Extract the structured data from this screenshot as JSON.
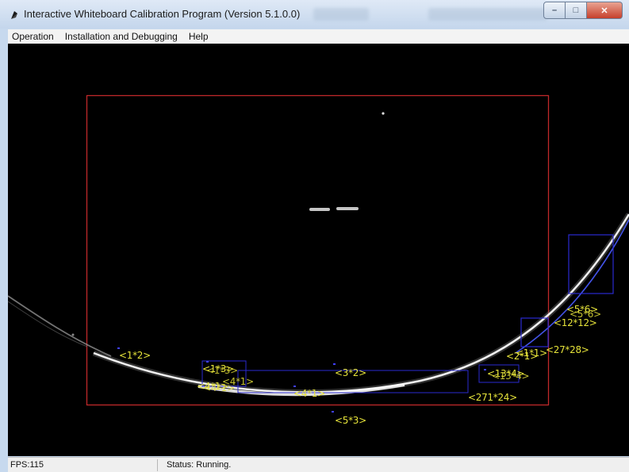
{
  "window": {
    "title": "Interactive Whiteboard Calibration Program (Version 5.1.0.0)",
    "controls": {
      "minimize": "–",
      "maximize": "□",
      "close": "✕"
    }
  },
  "menu": {
    "items": [
      "Operation",
      "Installation and Debugging",
      "Help"
    ]
  },
  "view": {
    "labels": [
      "<1*2>",
      "<1*3>",
      "<3*2>",
      "<4*1>",
      "<4*1>",
      "<5*3>",
      "<271*24>",
      "<2*1>",
      "<1*1>",
      "<27*28>",
      "<5*6>",
      "<12*12>",
      "<13*4>"
    ]
  },
  "status": {
    "fps": "FPS:115",
    "text": "Status: Running."
  },
  "colors": {
    "calibration_frame": "#c0282a",
    "region_box": "#2a2ad0",
    "label": "#e6e33a"
  }
}
